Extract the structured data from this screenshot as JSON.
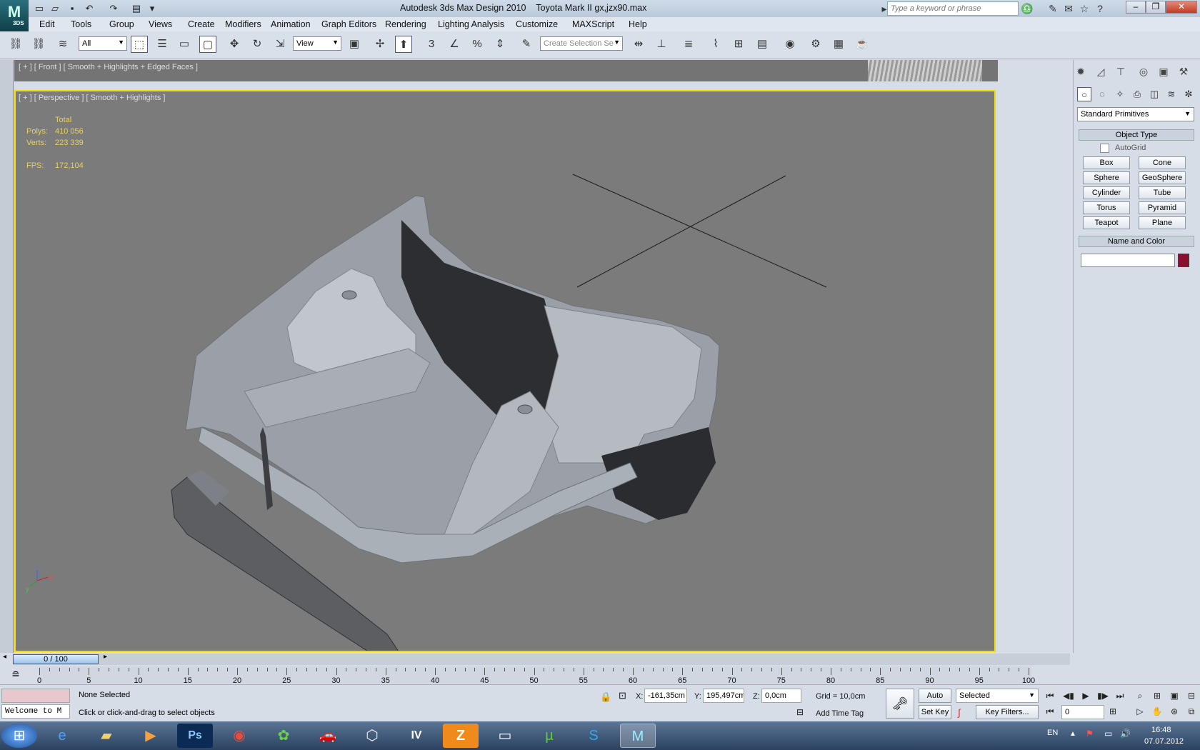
{
  "title": {
    "app": "Autodesk 3ds Max Design 2010",
    "file": "Toyota Mark II gx,jzx90.max",
    "search_placeholder": "Type a keyword or phrase",
    "logo_text": "M",
    "logo_sub": "3DS"
  },
  "menu": [
    "Edit",
    "Tools",
    "Group",
    "Views",
    "Create",
    "Modifiers",
    "Animation",
    "Graph Editors",
    "Rendering",
    "Lighting Analysis",
    "Customize",
    "MAXScript",
    "Help"
  ],
  "toolbar": {
    "filter_value": "All",
    "refcoord_value": "View",
    "selection_set_placeholder": "Create Selection Se"
  },
  "viewports": {
    "front_label": "[ + ] [ Front ] [ Smooth + Highlights + Edged Faces ]",
    "persp_label": "[ + ] [ Perspective ] [ Smooth + Highlights ]",
    "stats": {
      "total_label": "Total",
      "polys_label": "Polys:",
      "polys_value": "410 056",
      "verts_label": "Verts:",
      "verts_value": "223 339",
      "fps_label": "FPS:",
      "fps_value": "172,104"
    }
  },
  "command_panel": {
    "category": "Standard Primitives",
    "object_type_label": "Object Type",
    "autogrid_label": "AutoGrid",
    "primitives": [
      "Box",
      "Cone",
      "Sphere",
      "GeoSphere",
      "Cylinder",
      "Tube",
      "Torus",
      "Pyramid",
      "Teapot",
      "Plane"
    ],
    "name_color_label": "Name and Color",
    "color": "#8a1030"
  },
  "timeline": {
    "slider_text": "0 / 100",
    "ticks": [
      "0",
      "5",
      "10",
      "15",
      "20",
      "25",
      "30",
      "35",
      "40",
      "45",
      "50",
      "55",
      "60",
      "65",
      "70",
      "75",
      "80",
      "85",
      "90",
      "95",
      "100"
    ]
  },
  "status": {
    "maxscript_text": "Welcome to M",
    "selection": "None Selected",
    "prompt": "Click or click-and-drag to select objects",
    "x_label": "X:",
    "x_value": "-161,35cm",
    "y_label": "Y:",
    "y_value": "195,497cm",
    "z_label": "Z:",
    "z_value": "0,0cm",
    "grid": "Grid = 10,0cm",
    "add_time_tag": "Add Time Tag",
    "auto_key": "Auto Key",
    "set_key": "Set Key",
    "key_mode": "Selected",
    "key_filters": "Key Filters...",
    "frame": "0"
  },
  "taskbar": {
    "lang": "EN",
    "time": "16:48",
    "date": "07.07.2012"
  }
}
